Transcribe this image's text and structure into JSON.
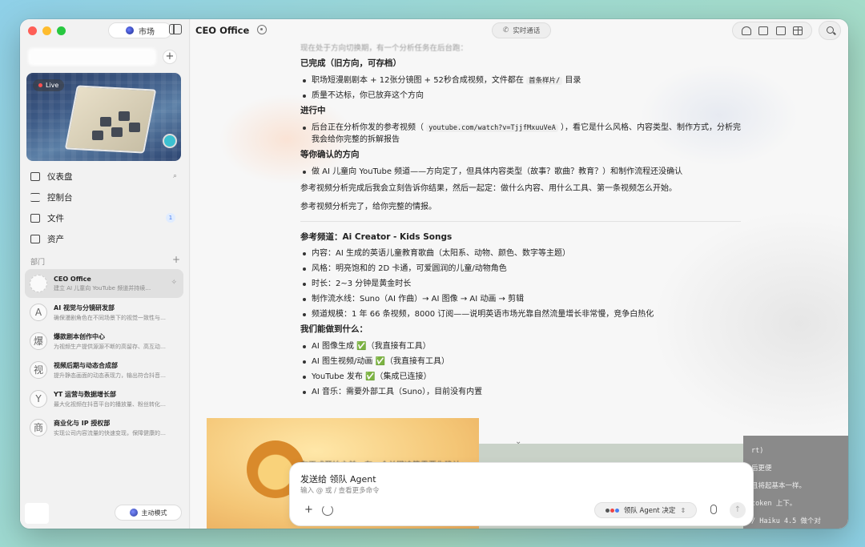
{
  "sidebar": {
    "market_label": "市场",
    "live_label": "Live",
    "nav": [
      {
        "label": "仪表盘",
        "icon": "dashboard-icon"
      },
      {
        "label": "控制台",
        "icon": "console-icon"
      },
      {
        "label": "文件",
        "icon": "folder-icon",
        "badge": "1"
      },
      {
        "label": "资产",
        "icon": "briefcase-icon"
      }
    ],
    "section_label": "部门",
    "departments": [
      {
        "title": "CEO Office",
        "sub": "建立 AI 儿童向 YouTube 频道并持续…",
        "avatar": "C",
        "active": true
      },
      {
        "title": "AI 视觉与分镜研发部",
        "sub": "确保漫剧角色在不同场景下的视觉一致性与…",
        "avatar": "A"
      },
      {
        "title": "爆款剧本创作中心",
        "sub": "为视频生产提供源源不断的高留存、高互动…",
        "avatar": "爆"
      },
      {
        "title": "视频后期与动态合成部",
        "sub": "提升静态画面的动态表现力，输出符合抖音…",
        "avatar": "视"
      },
      {
        "title": "YT 运营与数据增长部",
        "sub": "最大化视频在抖音平台的播放量、粉丝转化…",
        "avatar": "Y"
      },
      {
        "title": "商业化与 IP 授权部",
        "sub": "实现公司内容流量的快速变现，保障健康的…",
        "avatar": "商"
      }
    ],
    "mode_label": "主动模式"
  },
  "topbar": {
    "title": "CEO Office",
    "call_label": "实时通话"
  },
  "content": {
    "fade_top": "现在处于方向切换期，有一个分析任务在后台跑：",
    "done_heading": "已完成（旧方向，可存档）",
    "done_items": [
      {
        "pre": "职场短漫剧剧本 + 12张分镜图 + 52秒合成视频，文件都在 ",
        "code": "首条样片/",
        "post": " 目录"
      },
      {
        "pre": "质量不达标，你已放弃这个方向",
        "code": "",
        "post": ""
      }
    ],
    "progress_heading": "进行中",
    "progress_items": [
      {
        "pre": "后台正在分析你发的参考视频（ ",
        "code": "youtube.com/watch?v=TjjfMxuuVeA",
        "post": " ），看它是什么风格、内容类型、制作方式，分析完我会给你完整的拆解报告"
      }
    ],
    "pending_heading": "等你确认的方向",
    "pending_items": [
      {
        "pre": "做 AI 儿童向 YouTube 频道——方向定了，但具体内容类型（故事？歌曲？教育？）和制作流程还没确认",
        "code": "",
        "post": ""
      }
    ],
    "para1": "参考视频分析完成后我会立刻告诉你结果，然后一起定：做什么内容、用什么工具、第一条视频怎么开始。",
    "para2": "参考视频分析完了，给你完整的情报。",
    "ref_heading": "参考频道：Ai Creator - Kids Songs",
    "ref_items": [
      "内容：AI 生成的英语儿童教育歌曲（太阳系、动物、颜色、数字等主题）",
      "风格：明亮饱和的 2D 卡通，可爱圆润的儿童/动物角色",
      "时长：2~3 分钟是黄金时长",
      "制作流水线：Suno（AI 作曲）→ AI 图像 → AI 动画 → 剪辑",
      "频道规模：1 年 66 条视频，8000 订阅——说明英语市场光靠自然流量增长非常慢，竞争白热化"
    ],
    "can_heading": "我们能做到什么：",
    "can_items": [
      "AI 图像生成 ✅（我直接有工具）",
      "AI 图生视频/动画 ✅（我直接有工具）",
      "YouTube 发布 ✅（集成已连接）",
      "AI 音乐：需要外部工具（Suno），目前没有内置"
    ],
    "bottom_fade": "在正式开始之前，有一个关键决策需要你确认："
  },
  "terminal_ghost": [
    "rt)",
    "后更便",
    "且将起基本一样。",
    "token 上下。",
    "/ Haiku 4.5 做个对"
  ],
  "composer": {
    "title": "发送给 领队 Agent",
    "hint": "输入 @ 或 / 查看更多命令",
    "agent_label": "领队 Agent 决定"
  },
  "colors": {
    "accent": "#4a7df0",
    "window_bg": "#f7f7f7",
    "sidebar_bg": "#f2f2f2"
  }
}
